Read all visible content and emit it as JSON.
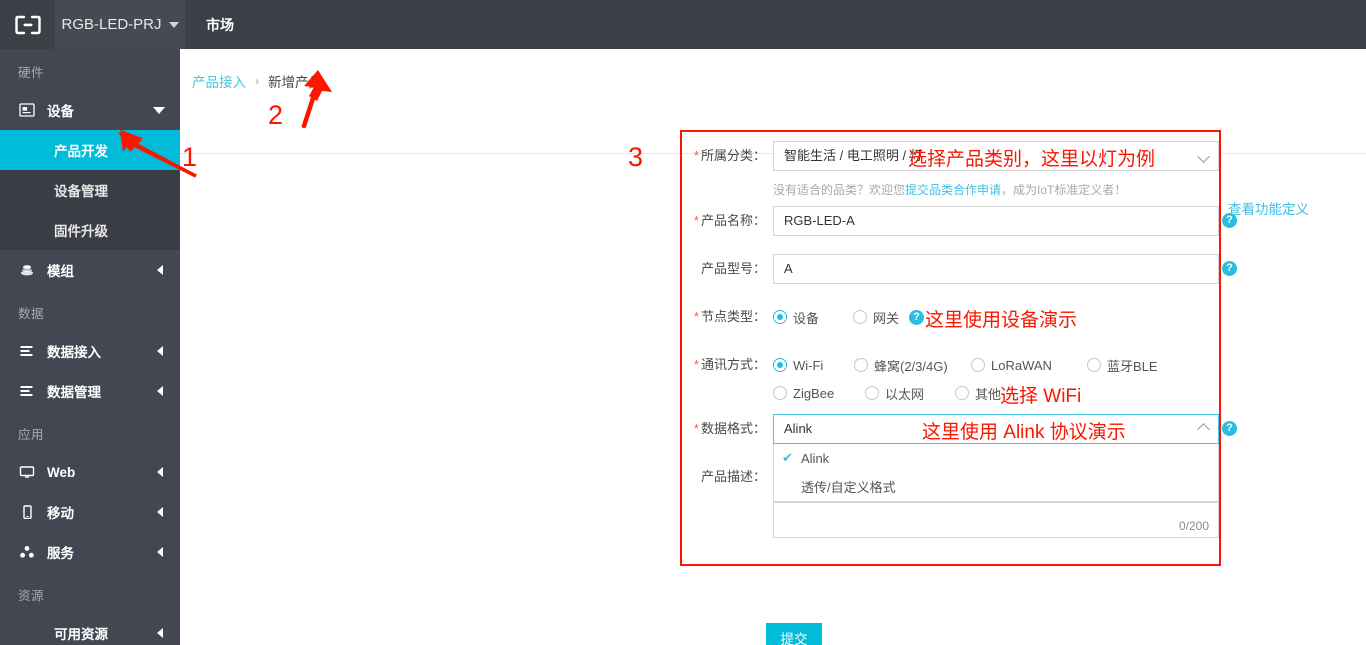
{
  "topbar": {
    "logo_icon": "link-bracket-icon",
    "project_name": "RGB-LED-PRJ",
    "project_caret": "chevron-down-icon",
    "market_label": "市场"
  },
  "sidebar": {
    "groups": [
      {
        "title": "硬件",
        "items": [
          {
            "label": "设备",
            "icon": "device-icon",
            "expanded": true,
            "arrow": "chevron-down-icon"
          }
        ],
        "submenu": [
          {
            "label": "产品开发",
            "active": true
          },
          {
            "label": "设备管理",
            "active": false
          },
          {
            "label": "固件升级",
            "active": false
          }
        ],
        "after": [
          {
            "label": "模组",
            "icon": "module-icon",
            "arrow": "chevron-left-icon"
          }
        ]
      },
      {
        "title": "数据",
        "items": [
          {
            "label": "数据接入",
            "icon": "data-in-icon",
            "arrow": "chevron-left-icon"
          },
          {
            "label": "数据管理",
            "icon": "data-manage-icon",
            "arrow": "chevron-left-icon"
          }
        ]
      },
      {
        "title": "应用",
        "items": [
          {
            "label": "Web",
            "icon": "monitor-icon",
            "arrow": "chevron-left-icon"
          },
          {
            "label": "移动",
            "icon": "mobile-icon",
            "arrow": "chevron-left-icon"
          },
          {
            "label": "服务",
            "icon": "service-icon",
            "arrow": "chevron-left-icon"
          }
        ]
      },
      {
        "title": "资源",
        "items": [
          {
            "label": "可用资源",
            "icon": "",
            "arrow": "chevron-left-icon"
          }
        ]
      }
    ]
  },
  "breadcrumb": {
    "parent": "产品接入",
    "separator": "›",
    "current": "新增产品"
  },
  "form": {
    "category": {
      "label": "所属分类：",
      "required": true,
      "value": "智能生活 / 电工照明 / 灯",
      "chevron": "chevron-down-icon"
    },
    "category_hint": {
      "prefix": "没有适合的品类？欢迎您",
      "link": "提交品类合作申请",
      "suffix": "，成为IoT标准定义者！"
    },
    "product_name": {
      "label": "产品名称：",
      "required": true,
      "value": "RGB-LED-A"
    },
    "product_model": {
      "label": "产品型号：",
      "required": false,
      "value": "A"
    },
    "node_type": {
      "label": "节点类型：",
      "required": true,
      "options": [
        {
          "label": "设备",
          "selected": true
        },
        {
          "label": "网关",
          "selected": false
        }
      ],
      "help_icon": "question-mark-icon"
    },
    "comm_type": {
      "label": "通讯方式：",
      "required": true,
      "options_row1": [
        {
          "label": "Wi-Fi",
          "selected": true
        },
        {
          "label": "蜂窝(2/3/4G)",
          "selected": false
        },
        {
          "label": "LoRaWAN",
          "selected": false
        },
        {
          "label": "蓝牙BLE",
          "selected": false
        }
      ],
      "options_row2": [
        {
          "label": "ZigBee",
          "selected": false
        },
        {
          "label": "以太网",
          "selected": false
        },
        {
          "label": "其他",
          "selected": false
        }
      ]
    },
    "data_format": {
      "label": "数据格式：",
      "required": true,
      "value": "Alink",
      "chevron": "chevron-up-icon",
      "help_icon": "question-mark-icon",
      "open": true,
      "options": [
        {
          "label": "Alink",
          "checked": true,
          "check_icon": "check-icon"
        },
        {
          "label": "透传/自定义格式",
          "checked": false
        }
      ]
    },
    "product_desc": {
      "label": "产品描述：",
      "required": false,
      "value": "",
      "counter": "0/200"
    },
    "submit_label": "提交",
    "function_def_link": "查看功能定义"
  },
  "annotations": {
    "num1": "1",
    "num2": "2",
    "num3": "3",
    "note_category": "选择产品类别，这里以灯为例",
    "note_node": "这里使用设备演示",
    "note_wifi": "选择 WiFi",
    "note_alink": "这里使用 Alink 协议演示"
  },
  "colors": {
    "accent": "#00bcd9",
    "sidebar_bg": "#434752",
    "submenu_bg": "#3a3d45",
    "topbar_bg": "#3b3f46",
    "annotation_red": "#fc1600",
    "link_blue": "#3fc0e3"
  }
}
